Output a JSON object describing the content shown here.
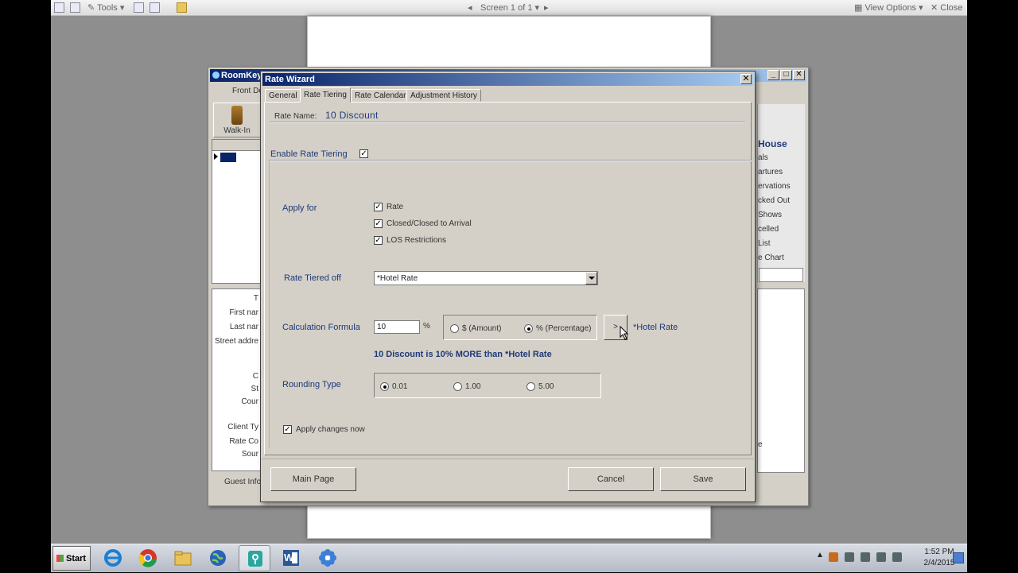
{
  "viewer": {
    "tools_label": "Tools",
    "screen_label": "Screen 1 of 1",
    "view_options_label": "View Options",
    "close_label": "Close"
  },
  "background_app": {
    "title": "RoomKey",
    "tab_front_desk": "Front De",
    "walkin_label": "Walk-In",
    "form_labels": [
      "T",
      "First nar",
      "Last nar",
      "Street addre",
      "C",
      "St",
      "Cour",
      "Client Ty",
      "Rate Co",
      "Sour"
    ],
    "guest_info_tab": "Guest Info",
    "right_panel_heading": "House",
    "right_panel_items": [
      "als",
      "artures",
      "ervations",
      "cked Out",
      "Shows",
      "celled",
      "List",
      "e Chart"
    ],
    "right_lower_text": "e"
  },
  "dialog": {
    "title": "Rate Wizard",
    "tabs": [
      "General",
      "Rate Tiering",
      "Rate Calendar",
      "Adjustment History"
    ],
    "active_tab": "Rate Tiering",
    "rate_name_label": "Rate Name:",
    "rate_name_value": "10 Discount",
    "enable_tiering_label": "Enable Rate Tiering",
    "enable_tiering_checked": true,
    "apply_for_label": "Apply for",
    "apply_for_options": [
      {
        "label": "Rate",
        "checked": true
      },
      {
        "label": "Closed/Closed to Arrival",
        "checked": true
      },
      {
        "label": "LOS Restrictions",
        "checked": true
      }
    ],
    "rate_tiered_off_label": "Rate Tiered off",
    "rate_tiered_off_value": "*Hotel Rate",
    "calc_formula_label": "Calculation Formula",
    "calc_value": "10",
    "calc_unit": "%",
    "calc_type_amount": "$ (Amount)",
    "calc_type_percentage": "% (Percentage)",
    "calc_type_selected": "percentage",
    "arrow_button_label": ">",
    "target_rate_label": "*Hotel Rate",
    "summary_text": "10 Discount is 10% MORE than *Hotel Rate",
    "rounding_label": "Rounding Type",
    "rounding_options": [
      "0.01",
      "1.00",
      "5.00"
    ],
    "rounding_selected": "0.01",
    "apply_now_label": "Apply changes now",
    "apply_now_checked": true,
    "main_page_button": "Main Page",
    "cancel_button": "Cancel",
    "save_button": "Save"
  },
  "taskbar": {
    "start_label": "Start",
    "apps": [
      "internet-explorer-icon",
      "chrome-icon",
      "file-explorer-icon",
      "globe-icon",
      "roomkey-icon",
      "word-icon",
      "flower-app-icon"
    ],
    "word_letter": "W",
    "time": "1:52 PM",
    "date": "2/4/2015"
  },
  "colors": {
    "label_blue": "#1e3a78",
    "titlebar_start": "#0a246a",
    "titlebar_end": "#a6caf0",
    "dialog_face": "#d4d0c8"
  }
}
